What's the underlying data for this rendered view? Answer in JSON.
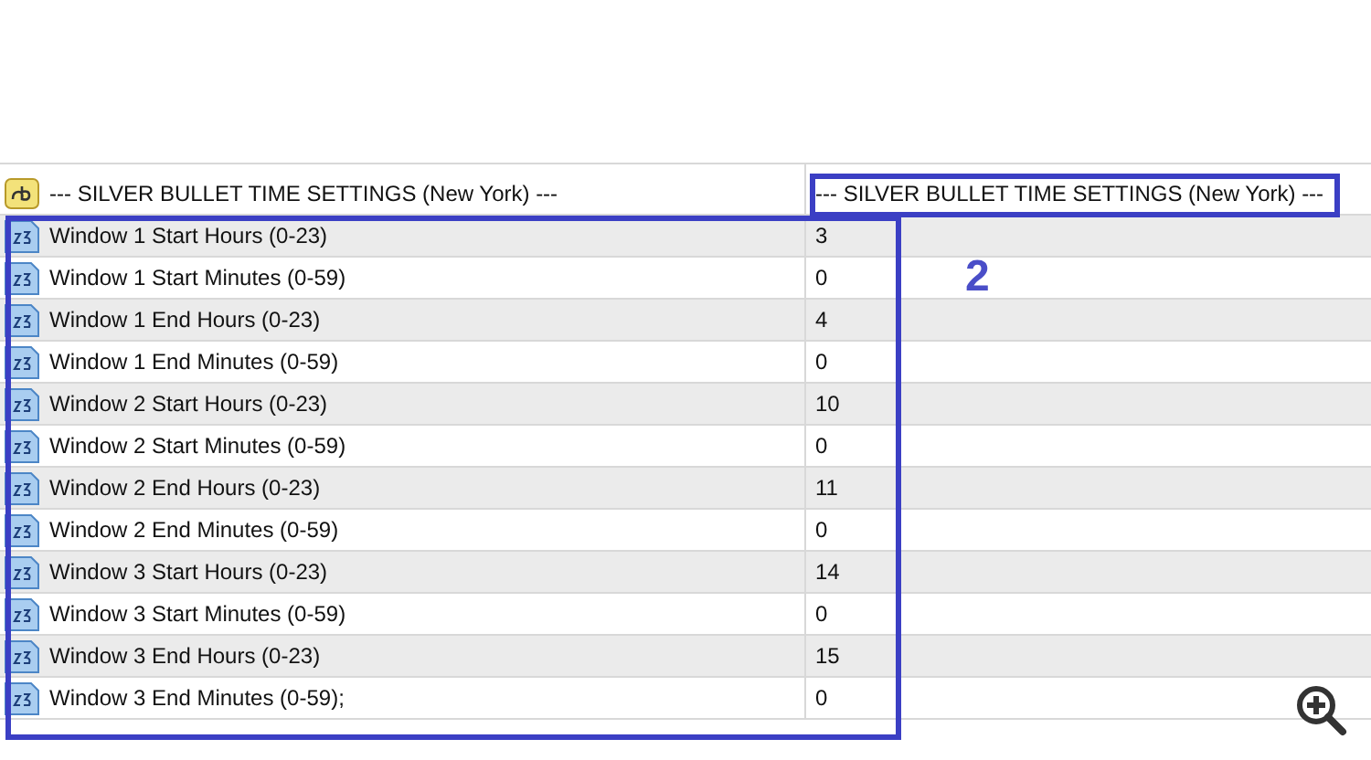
{
  "parameters": [
    {
      "kind": "string",
      "name": "--- SILVER BULLET TIME SETTINGS (New York) ---",
      "value": "--- SILVER BULLET TIME SETTINGS (New York) ---"
    },
    {
      "kind": "int",
      "name": "Window 1 Start Hours (0-23)",
      "value": "3"
    },
    {
      "kind": "int",
      "name": "Window 1 Start Minutes (0-59)",
      "value": "0"
    },
    {
      "kind": "int",
      "name": "Window 1 End Hours (0-23)",
      "value": "4"
    },
    {
      "kind": "int",
      "name": "Window 1 End Minutes (0-59)",
      "value": "0"
    },
    {
      "kind": "int",
      "name": "Window 2 Start Hours (0-23)",
      "value": "10"
    },
    {
      "kind": "int",
      "name": "Window 2 Start Minutes (0-59)",
      "value": "0"
    },
    {
      "kind": "int",
      "name": "Window 2 End Hours (0-23)",
      "value": "11"
    },
    {
      "kind": "int",
      "name": "Window 2 End Minutes (0-59)",
      "value": "0"
    },
    {
      "kind": "int",
      "name": "Window 3 Start Hours (0-23)",
      "value": "14"
    },
    {
      "kind": "int",
      "name": "Window 3 Start Minutes (0-59)",
      "value": "0"
    },
    {
      "kind": "int",
      "name": "Window 3 End Hours (0-23)",
      "value": "15"
    },
    {
      "kind": "int",
      "name": "Window 3 End Minutes (0-59);",
      "value": "0"
    }
  ],
  "annotation": {
    "label": "2"
  }
}
